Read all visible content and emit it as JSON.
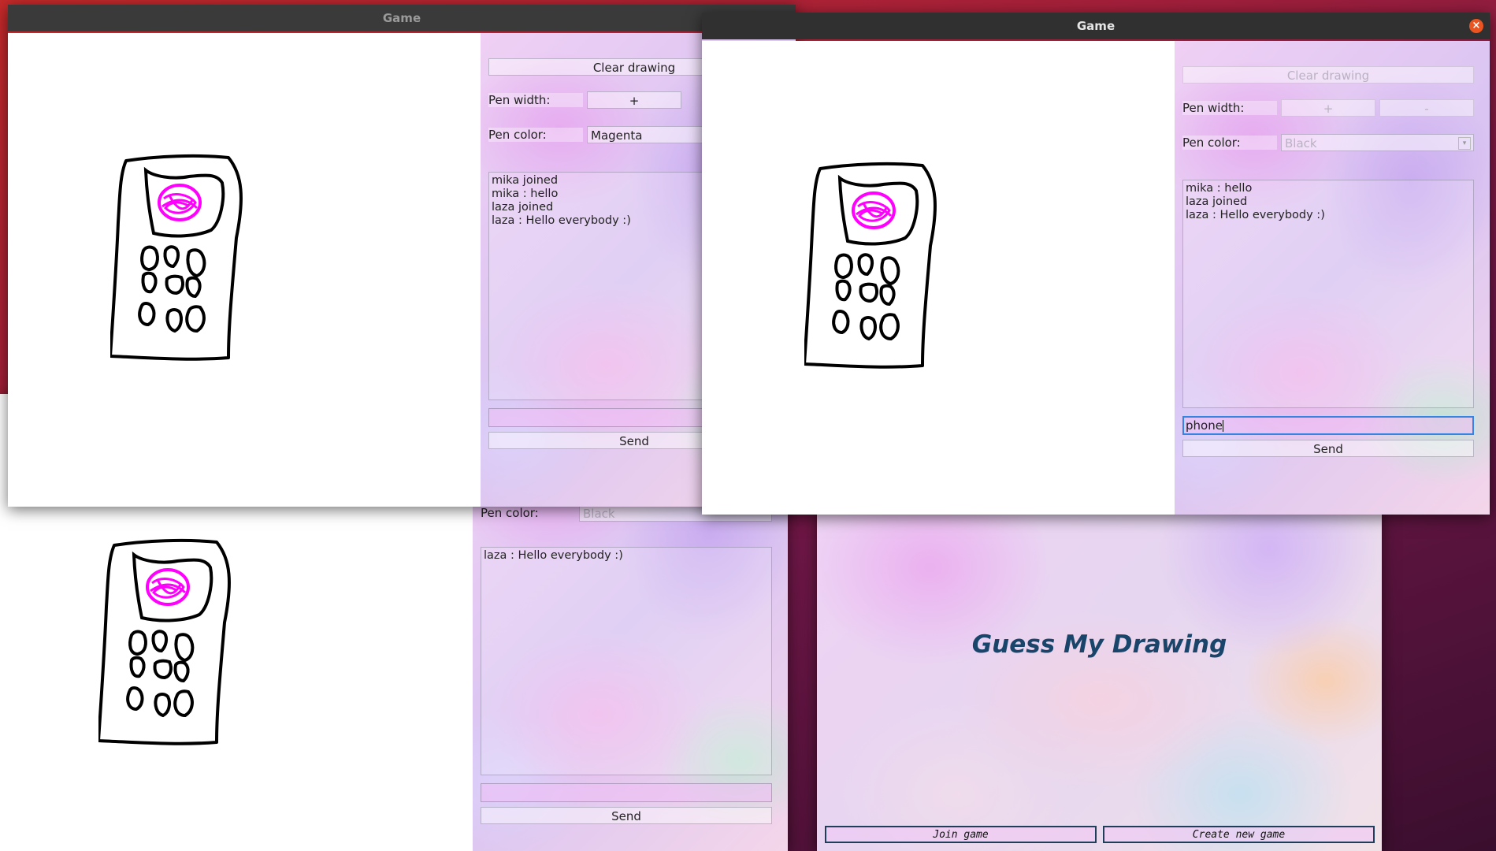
{
  "bg_window": {
    "pen_color_label": "Pen color:",
    "pen_color_value": "Black",
    "chat_messages": [
      "laza : Hello everybody :)"
    ],
    "input_value": "",
    "send_label": "Send"
  },
  "menu_window": {
    "app_title": "Guess My Drawing",
    "join_label": "Join game",
    "create_label": "Create new game"
  },
  "window_left": {
    "title": "Game",
    "clear_label": "Clear drawing",
    "pen_width_label": "Pen width:",
    "plus_label": "+",
    "pen_color_label": "Pen color:",
    "pen_color_value": "Magenta",
    "chat_messages": [
      "mika joined",
      "mika : hello",
      "laza joined",
      "laza : Hello everybody :)"
    ],
    "input_value": "",
    "send_label": "Send"
  },
  "window_right": {
    "title": "Game",
    "clear_label": "Clear drawing",
    "pen_width_label": "Pen width:",
    "plus_label": "+",
    "minus_label": "-",
    "pen_color_label": "Pen color:",
    "pen_color_value": "Black",
    "chat_messages": [
      "mika : hello",
      "laza joined",
      "laza : Hello everybody :)"
    ],
    "input_value": "phone",
    "send_label": "Send",
    "close_icon": "×"
  },
  "colors": {
    "pen_black": "#000000",
    "pen_magenta": "#ff00ff",
    "titlebar": "#303030",
    "close_button": "#e95420",
    "menu_title": "#19456b"
  },
  "icons": [
    "close-icon",
    "chevron-down-icon"
  ]
}
